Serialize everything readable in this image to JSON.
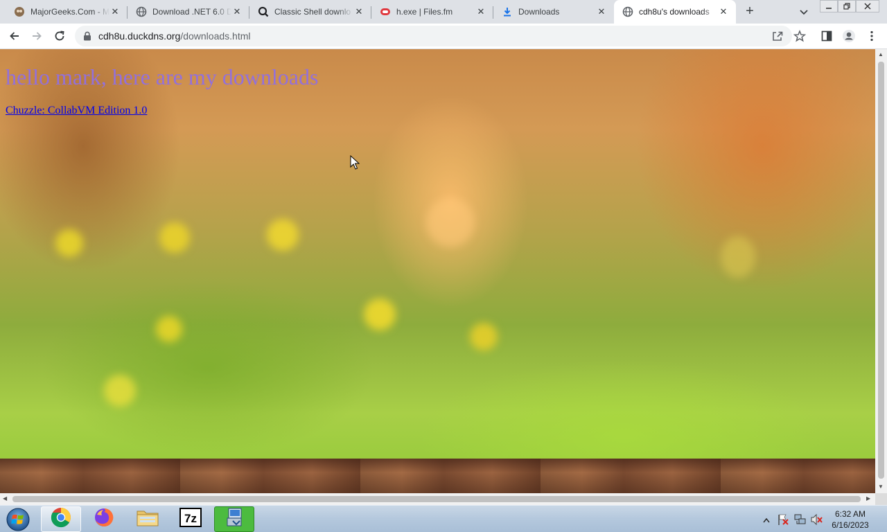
{
  "tabs": [
    {
      "title": "MajorGeeks.Com - M",
      "icon": "majorgeeks-icon"
    },
    {
      "title": "Download .NET 6.0 D",
      "icon": "globe-icon"
    },
    {
      "title": "Classic Shell downlo",
      "icon": "search-icon"
    },
    {
      "title": "h.exe | Files.fm",
      "icon": "filesfm-icon"
    },
    {
      "title": "Downloads",
      "icon": "download-icon"
    },
    {
      "title": "cdh8u's downloads",
      "icon": "globe-icon",
      "active": true
    }
  ],
  "toolbar": {
    "url_host": "cdh8u.duckdns.org",
    "url_path": "/downloads.html"
  },
  "page": {
    "heading": "hello mark, here are my downloads",
    "link": "Chuzzle: CollabVM Edition 1.0",
    "heading_color": "#9370db",
    "link_color": "#0000ee"
  },
  "taskbar": {
    "apps": [
      "chrome-icon",
      "firefox-icon",
      "file-explorer-icon",
      "7zip-icon",
      "installer-icon"
    ],
    "clock_time": "6:32 AM",
    "clock_date": "6/16/2023"
  }
}
